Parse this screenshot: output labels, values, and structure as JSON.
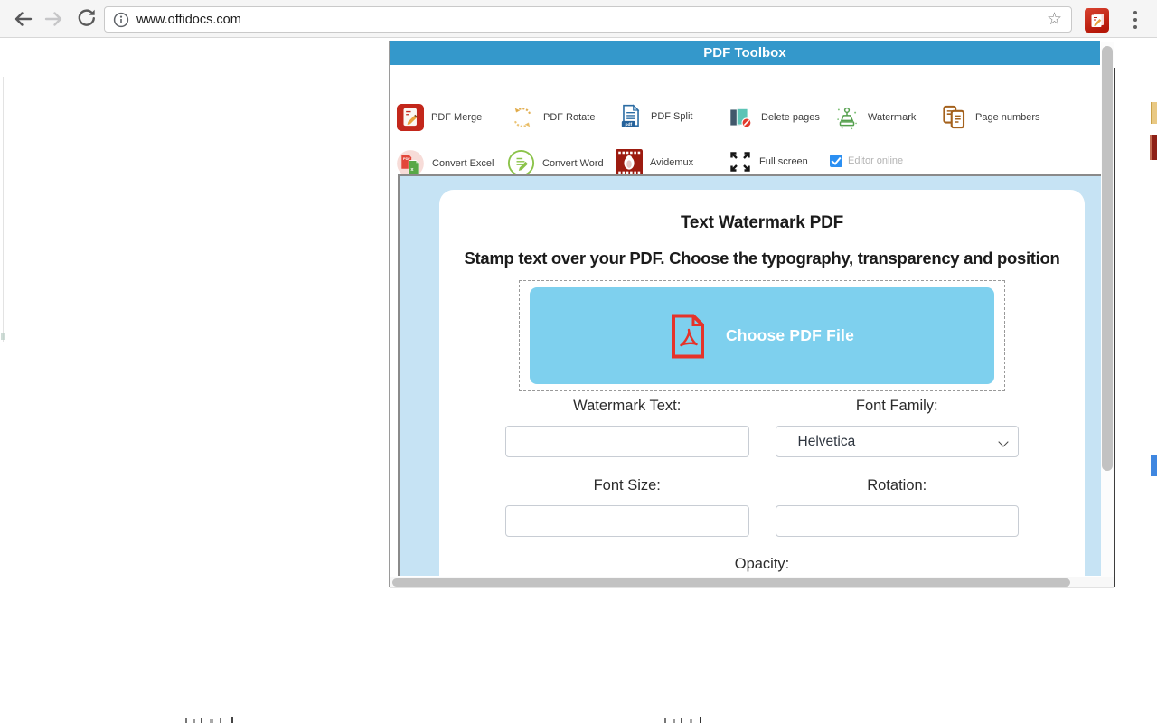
{
  "browser": {
    "url": "www.offidocs.com",
    "icons": {
      "back": "left-arrow",
      "forward": "right-arrow-disabled",
      "reload": "circular-arrow",
      "info": "circle-i",
      "bookmark": "star-outline",
      "extension": "offidocs-red-doc-pencil",
      "menu": "three-vertical-dots"
    }
  },
  "app": {
    "title": "PDF Toolbox",
    "toolbar": {
      "row1": [
        {
          "label": "PDF Merge",
          "icon": "pdf-merge-icon"
        },
        {
          "label": "PDF Rotate",
          "icon": "pdf-rotate-icon"
        },
        {
          "label": "PDF Split",
          "icon": "pdf-split-icon"
        },
        {
          "label": "Delete pages",
          "icon": "delete-pages-icon"
        },
        {
          "label": "Watermark",
          "icon": "watermark-stamp-icon"
        },
        {
          "label": "Page numbers",
          "icon": "page-numbers-icon"
        }
      ],
      "row2": [
        {
          "label": "Convert Excel",
          "icon": "convert-excel-icon"
        },
        {
          "label": "Convert Word",
          "icon": "convert-word-icon"
        },
        {
          "label": "Avidemux",
          "icon": "avidemux-film-icon"
        },
        {
          "label": "Full screen",
          "icon": "fullscreen-arrows-icon"
        }
      ],
      "editor_online": {
        "label": "Editor online",
        "checked": true
      }
    },
    "panel": {
      "title": "Text Watermark PDF",
      "subtitle": "Stamp text over your PDF. Choose the typography, transparency and position",
      "choose_button": "Choose PDF File",
      "choose_icon": "pdf-file-icon",
      "fields": {
        "watermark_text": {
          "label": "Watermark Text:",
          "value": ""
        },
        "font_family": {
          "label": "Font Family:",
          "value": "Helvetica"
        },
        "font_size": {
          "label": "Font Size:",
          "value": ""
        },
        "rotation": {
          "label": "Rotation:",
          "value": ""
        },
        "opacity": {
          "label": "Opacity:"
        }
      }
    }
  },
  "colors": {
    "header_blue": "#3498cb",
    "panel_light_blue": "#c6e3f4",
    "choose_button_blue": "#7ed0ee",
    "pdf_red": "#e5332a",
    "checkbox_blue": "#2b8ff2",
    "scroll_thumb": "#c2c2c2"
  }
}
